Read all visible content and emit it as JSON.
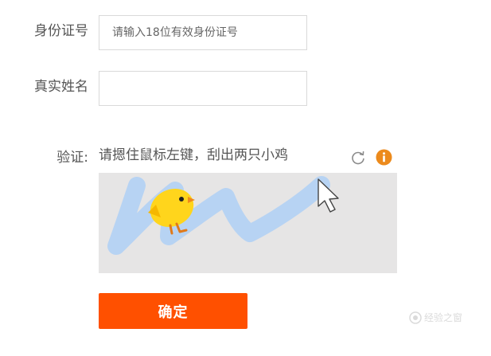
{
  "form": {
    "id_label": "身份证号",
    "id_placeholder": "请输入18位有效身份证号",
    "id_value": "",
    "name_label": "真实姓名",
    "name_placeholder": "",
    "name_value": ""
  },
  "captcha": {
    "label": "验证:",
    "instruction": "请摁住鼠标左键，刮出两只小鸡",
    "refresh_icon": "refresh-icon",
    "info_icon": "info-icon",
    "stroke_color": "#b7d3f3",
    "canvas_bg": "#e6e5e5",
    "chick_color": "#ffd51c"
  },
  "submit": {
    "label": "确定",
    "color": "#ff5000"
  },
  "watermark": {
    "text": "经验之窗"
  }
}
